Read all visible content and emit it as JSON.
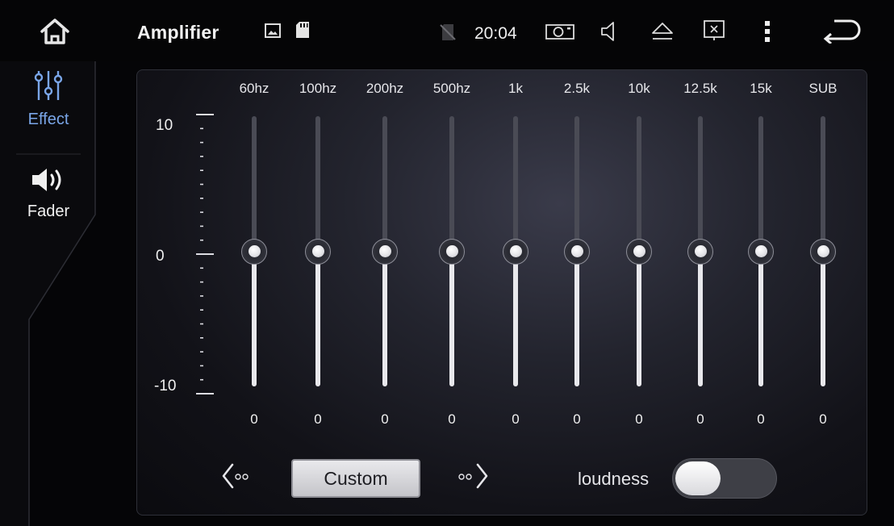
{
  "statusbar": {
    "title": "Amplifier",
    "time": "20:04",
    "icons": [
      "home-icon",
      "image-icon",
      "sd-card-icon",
      "no-sim-icon",
      "camera-icon",
      "volume-icon",
      "eject-icon",
      "screen-off-icon",
      "more-menu-icon",
      "back-icon"
    ]
  },
  "nav": {
    "items": [
      {
        "label": "Effect",
        "icon": "equalizer-icon",
        "active": true,
        "color": "#7aa6e8"
      },
      {
        "label": "Fader",
        "icon": "speaker-icon",
        "active": false
      }
    ]
  },
  "equalizer": {
    "scale": {
      "top": "10",
      "mid": "0",
      "bottom": "-10"
    },
    "range": [
      -10,
      10
    ],
    "bands": [
      {
        "label": "60hz",
        "value": 0
      },
      {
        "label": "100hz",
        "value": 0
      },
      {
        "label": "200hz",
        "value": 0
      },
      {
        "label": "500hz",
        "value": 0
      },
      {
        "label": "1k",
        "value": 0
      },
      {
        "label": "2.5k",
        "value": 0
      },
      {
        "label": "10k",
        "value": 0
      },
      {
        "label": "12.5k",
        "value": 0
      },
      {
        "label": "15k",
        "value": 0
      },
      {
        "label": "SUB",
        "value": 0
      }
    ]
  },
  "controls": {
    "preset": "Custom",
    "prev_icon": "prev-preset-icon",
    "next_icon": "next-preset-icon",
    "loudness_label": "loudness",
    "loudness_on": false
  }
}
